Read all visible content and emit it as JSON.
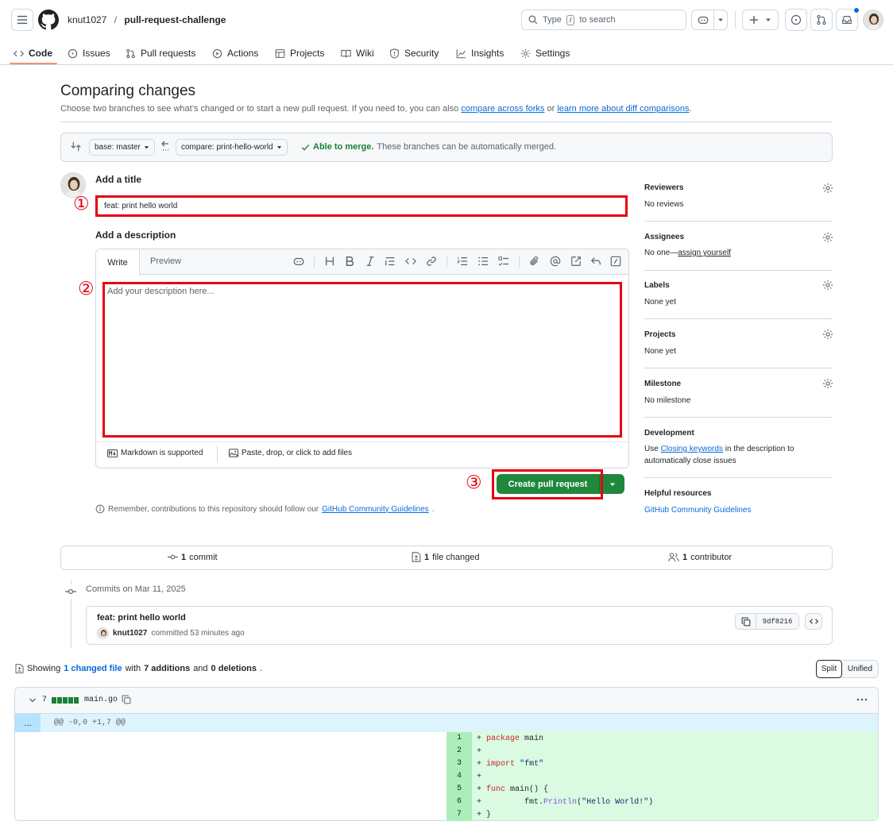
{
  "header": {
    "owner": "knut1027",
    "separator": "/",
    "repo": "pull-request-challenge",
    "search_prefix": "Type",
    "search_key": "/",
    "search_suffix": "to search"
  },
  "tabs": [
    {
      "label": "Code",
      "icon": "code-icon"
    },
    {
      "label": "Issues",
      "icon": "issue-icon"
    },
    {
      "label": "Pull requests",
      "icon": "pull-request-icon"
    },
    {
      "label": "Actions",
      "icon": "play-icon"
    },
    {
      "label": "Projects",
      "icon": "table-icon"
    },
    {
      "label": "Wiki",
      "icon": "book-icon"
    },
    {
      "label": "Security",
      "icon": "shield-icon"
    },
    {
      "label": "Insights",
      "icon": "graph-icon"
    },
    {
      "label": "Settings",
      "icon": "gear-icon"
    }
  ],
  "compare": {
    "title": "Comparing changes",
    "subtitle_prefix": "Choose two branches to see what’s changed or to start a new pull request. If you need to, you can also",
    "link_forks": "compare across forks",
    "subtitle_or": "or",
    "link_learn": "learn more about diff comparisons",
    "subtitle_end": ".",
    "base_label": "base: master",
    "compare_label": "compare: print-hello-world",
    "merge_status": "Able to merge.",
    "merge_note": "These branches can be automatically merged."
  },
  "form": {
    "title_heading": "Add a title",
    "title_value": "feat: print hello world",
    "desc_heading": "Add a description",
    "tab_write": "Write",
    "tab_preview": "Preview",
    "desc_placeholder": "Add your description here...",
    "markdown_note": "Markdown is supported",
    "attach_note": "Paste, drop, or click to add files",
    "create_button": "Create pull request",
    "reminder_prefix": "Remember, contributions to this repository should follow our",
    "reminder_link": "GitHub Community Guidelines",
    "reminder_end": "."
  },
  "annotations": {
    "one": "①",
    "two": "②",
    "three": "③"
  },
  "sidebar": {
    "reviewers_h": "Reviewers",
    "reviewers_v": "No reviews",
    "assignees_h": "Assignees",
    "assignees_v": "No one—",
    "assignees_link": "assign yourself",
    "labels_h": "Labels",
    "labels_v": "None yet",
    "projects_h": "Projects",
    "projects_v": "None yet",
    "milestone_h": "Milestone",
    "milestone_v": "No milestone",
    "development_h": "Development",
    "development_pre": "Use",
    "development_link": "Closing keywords",
    "development_post": "in the description to",
    "development_line2": "automatically close issues",
    "helpful_h": "Helpful resources",
    "helpful_link": "GitHub Community Guidelines"
  },
  "summary": {
    "commits_n": "1",
    "commits_label": "commit",
    "files_n": "1",
    "files_label": "file changed",
    "contrib_n": "1",
    "contrib_label": "contributor"
  },
  "commits": {
    "date_heading": "Commits on Mar 11, 2025",
    "message": "feat: print hello world",
    "author": "knut1027",
    "meta": "committed 53 minutes ago",
    "sha": "9df8216"
  },
  "diffstat": {
    "showing": "Showing",
    "changed_link": "1 changed file",
    "with": "with",
    "additions": "7 additions",
    "and": "and",
    "deletions": "0 deletions",
    "end": ".",
    "split": "Split",
    "unified": "Unified"
  },
  "file": {
    "count": "7",
    "name": "main.go",
    "expander": "...",
    "hunk": "@@ -0,0 +1,7 @@",
    "lines": [
      {
        "n": "1",
        "sign": "+",
        "kw": "package",
        "rest": " main"
      },
      {
        "n": "2",
        "sign": "+",
        "kw": "",
        "rest": ""
      },
      {
        "n": "3",
        "sign": "+",
        "kw": "import",
        "rest": " \"fmt\""
      },
      {
        "n": "4",
        "sign": "+",
        "kw": "",
        "rest": ""
      },
      {
        "n": "5",
        "sign": "+",
        "kw": "func",
        "rest": " main() {"
      },
      {
        "n": "6",
        "sign": "+",
        "kw": "",
        "rest": "        fmt.Println(\"Hello World!\")"
      },
      {
        "n": "7",
        "sign": "+",
        "kw": "",
        "rest": "}"
      }
    ]
  },
  "colors": {
    "accent": "#0969da",
    "primary_btn": "#1f883d",
    "annotation_red": "#e60012",
    "addition_bg": "#dafbe1"
  }
}
